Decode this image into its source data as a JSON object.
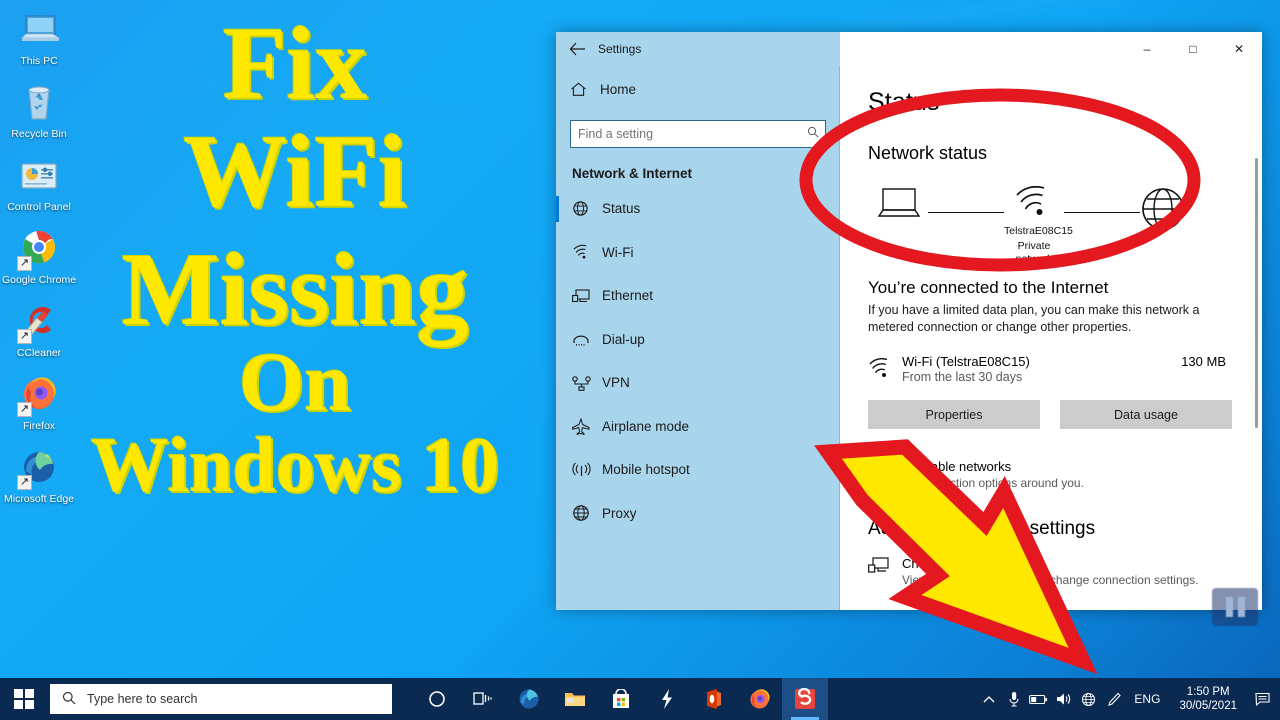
{
  "promo": {
    "line1": "Fix",
    "line2": "WiFi",
    "line3": "Missing",
    "line4": "On",
    "line5": "Windows 10"
  },
  "desktop": {
    "icons": [
      {
        "label": "This PC",
        "icon": "computer-icon",
        "shortcut": false
      },
      {
        "label": "Recycle Bin",
        "icon": "recycle-bin-icon",
        "shortcut": false
      },
      {
        "label": "Control Panel",
        "icon": "control-panel-icon",
        "shortcut": false
      },
      {
        "label": "Google Chrome",
        "icon": "chrome-icon",
        "shortcut": true
      },
      {
        "label": "CCleaner",
        "icon": "ccleaner-icon",
        "shortcut": true
      },
      {
        "label": "Firefox",
        "icon": "firefox-icon",
        "shortcut": true
      },
      {
        "label": "Microsoft Edge",
        "icon": "edge-icon",
        "shortcut": true
      }
    ]
  },
  "window": {
    "title": "Settings",
    "back_icon": "back-arrow-icon",
    "minimize": "–",
    "maximize": "□",
    "close": "✕"
  },
  "sidebar": {
    "home_label": "Home",
    "search_placeholder": "Find a setting",
    "search_value": "",
    "category": "Network & Internet",
    "items": [
      {
        "label": "Status",
        "icon": "status-globe-icon",
        "selected": true
      },
      {
        "label": "Wi-Fi",
        "icon": "wifi-icon",
        "selected": false
      },
      {
        "label": "Ethernet",
        "icon": "ethernet-icon",
        "selected": false
      },
      {
        "label": "Dial-up",
        "icon": "dialup-icon",
        "selected": false
      },
      {
        "label": "VPN",
        "icon": "vpn-icon",
        "selected": false
      },
      {
        "label": "Airplane mode",
        "icon": "airplane-icon",
        "selected": false
      },
      {
        "label": "Mobile hotspot",
        "icon": "hotspot-icon",
        "selected": false
      },
      {
        "label": "Proxy",
        "icon": "proxy-globe-icon",
        "selected": false
      }
    ]
  },
  "main": {
    "page_title": "Status",
    "network_status_heading": "Network status",
    "diagram": {
      "device_icon": "laptop-icon",
      "wifi_icon": "wifi-icon",
      "internet_icon": "globe-icon",
      "network_name": "TelstraE08C15",
      "network_type": "Private network"
    },
    "connected_heading": "You’re connected to the Internet",
    "connected_desc": "If you have a limited data plan, you can make this network a metered connection or change other properties.",
    "usage": {
      "icon": "wifi-icon",
      "name": "Wi-Fi (TelstraE08C15)",
      "period": "From the last 30 days",
      "amount": "130 MB"
    },
    "buttons": {
      "properties": "Properties",
      "data_usage": "Data usage"
    },
    "show_networks": {
      "title": "Show available networks",
      "desc": "View the connection options around you."
    },
    "advanced_heading": "Advanced network settings",
    "advanced_item": {
      "icon": "adapter-icon",
      "title": "Change adapter options",
      "desc": "View network adapters and change connection settings."
    }
  },
  "annotations": {
    "ellipse_color": "#e4181f",
    "arrow_fill": "#ffe800",
    "arrow_stroke": "#e4181f"
  },
  "taskbar": {
    "start_icon": "windows-logo-icon",
    "search_icon": "search-icon",
    "search_placeholder": "Type here to search",
    "items": [
      {
        "name": "cortana-icon",
        "active": false
      },
      {
        "name": "task-view-icon",
        "active": false
      },
      {
        "name": "edge-icon",
        "active": false
      },
      {
        "name": "file-explorer-icon",
        "active": false
      },
      {
        "name": "microsoft-store-icon",
        "active": false
      },
      {
        "name": "lightning-icon",
        "active": false
      },
      {
        "name": "office-icon",
        "active": false
      },
      {
        "name": "firefox-icon",
        "active": false
      },
      {
        "name": "snagit-icon",
        "active": true
      }
    ],
    "tray": {
      "chevron": "∧",
      "icons": [
        "microphone-icon",
        "battery-icon",
        "volume-icon",
        "network-globe-icon",
        "pen-icon"
      ],
      "language": "ENG",
      "time": "1:50 PM",
      "date": "30/05/2021",
      "action_center": "action-center-icon"
    }
  },
  "overlay": {
    "pause_icon": "pause-icon"
  }
}
